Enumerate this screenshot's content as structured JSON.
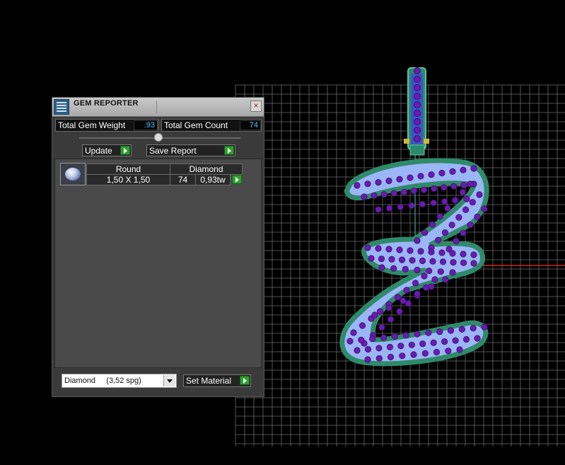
{
  "panel": {
    "title": "GEM REPORTER",
    "close_glyph": "×",
    "total_weight_label": "Total Gem Weight",
    "total_weight_value": ".93",
    "total_count_label": "Total Gem Count",
    "total_count_value": "74",
    "update_label": "Update",
    "save_report_label": "Save Report"
  },
  "gem_row": {
    "icon": "round-gem-icon",
    "shape": "Round",
    "material": "Diamond",
    "size": "1,50 X 1,50",
    "count": "74",
    "weight": "0,93tw"
  },
  "footer": {
    "material_value": "Diamond     (3,52 spg)",
    "set_material_label": "Set Material"
  },
  "colors": {
    "accent_green": "#2fa12f",
    "value_blue": "#48c8ff",
    "gem_blue": "#9bb6f6",
    "stone_purple": "#6a1bb0",
    "outline_teal": "#2f8a6a"
  }
}
